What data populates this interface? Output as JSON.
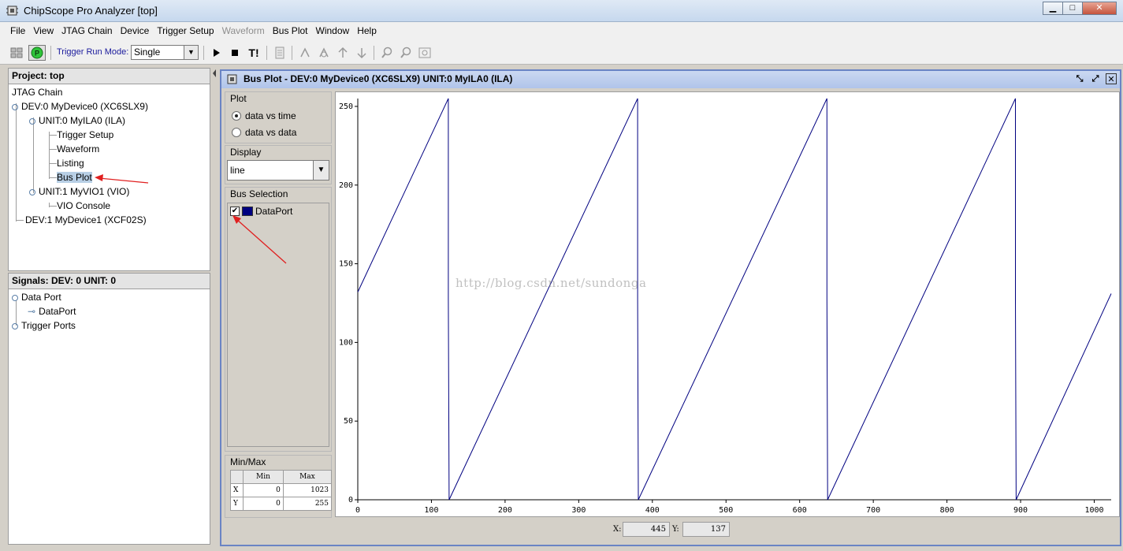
{
  "window": {
    "title": "ChipScope Pro Analyzer [top]"
  },
  "menu": [
    {
      "label": "File",
      "enabled": true
    },
    {
      "label": "View",
      "enabled": true
    },
    {
      "label": "JTAG Chain",
      "enabled": true
    },
    {
      "label": "Device",
      "enabled": true
    },
    {
      "label": "Trigger Setup",
      "enabled": true
    },
    {
      "label": "Waveform",
      "enabled": false
    },
    {
      "label": "Bus Plot",
      "enabled": true
    },
    {
      "label": "Window",
      "enabled": true
    },
    {
      "label": "Help",
      "enabled": true
    }
  ],
  "toolbar": {
    "trigger_run_mode_label": "Trigger Run Mode:",
    "trigger_run_mode_value": "Single",
    "trigger_now_label": "T!"
  },
  "project": {
    "header": "Project: top",
    "tree": {
      "root": "JTAG Chain",
      "dev0": "DEV:0 MyDevice0 (XC6SLX9)",
      "unit0": "UNIT:0 MyILA0 (ILA)",
      "trigger_setup": "Trigger Setup",
      "waveform": "Waveform",
      "listing": "Listing",
      "bus_plot": "Bus Plot",
      "unit1": "UNIT:1 MyVIO1 (VIO)",
      "vio_console": "VIO Console",
      "dev1": "DEV:1 MyDevice1 (XCF02S)"
    }
  },
  "signals": {
    "header": "Signals: DEV: 0 UNIT: 0",
    "data_port": "Data Port",
    "data_port_child": "DataPort",
    "trigger_ports": "Trigger Ports"
  },
  "bus_plot": {
    "title": "Bus Plot - DEV:0 MyDevice0 (XC6SLX9) UNIT:0 MyILA0 (ILA)",
    "plot_group": "Plot",
    "plot_options": [
      "data vs time",
      "data vs data"
    ],
    "plot_selected": "data vs time",
    "display_group": "Display",
    "display_value": "line",
    "bus_selection_group": "Bus Selection",
    "bus_name": "DataPort",
    "bus_checked": true,
    "bus_color": "#000080",
    "minmax_group": "Min/Max",
    "minmax_headers": [
      "",
      "Min",
      "Max"
    ],
    "minmax_rows": [
      {
        "axis": "X",
        "min": "0",
        "max": "1023"
      },
      {
        "axis": "Y",
        "min": "0",
        "max": "255"
      }
    ],
    "cursor": {
      "x_label": "X:",
      "x_value": "445",
      "y_label": "Y:",
      "y_value": "137"
    }
  },
  "watermark": "http://blog.csdn.net/sundonga",
  "chart_data": {
    "type": "line",
    "title": "",
    "xlabel": "",
    "ylabel": "",
    "xlim": [
      0,
      1023
    ],
    "ylim": [
      0,
      255
    ],
    "x_ticks": [
      0,
      100,
      200,
      300,
      400,
      500,
      600,
      700,
      800,
      900,
      1000
    ],
    "y_ticks": [
      0,
      50,
      100,
      150,
      200,
      250
    ],
    "series": [
      {
        "color": "#000080",
        "points": [
          [
            0,
            132
          ],
          [
            123,
            255
          ],
          [
            123,
            128
          ],
          [
            124,
            0
          ],
          [
            380,
            255
          ],
          [
            380,
            128
          ],
          [
            381,
            0
          ],
          [
            637,
            255
          ],
          [
            637,
            128
          ],
          [
            638,
            0
          ],
          [
            893,
            255
          ],
          [
            893,
            128
          ],
          [
            894,
            0
          ],
          [
            1023,
            131
          ]
        ]
      }
    ]
  }
}
